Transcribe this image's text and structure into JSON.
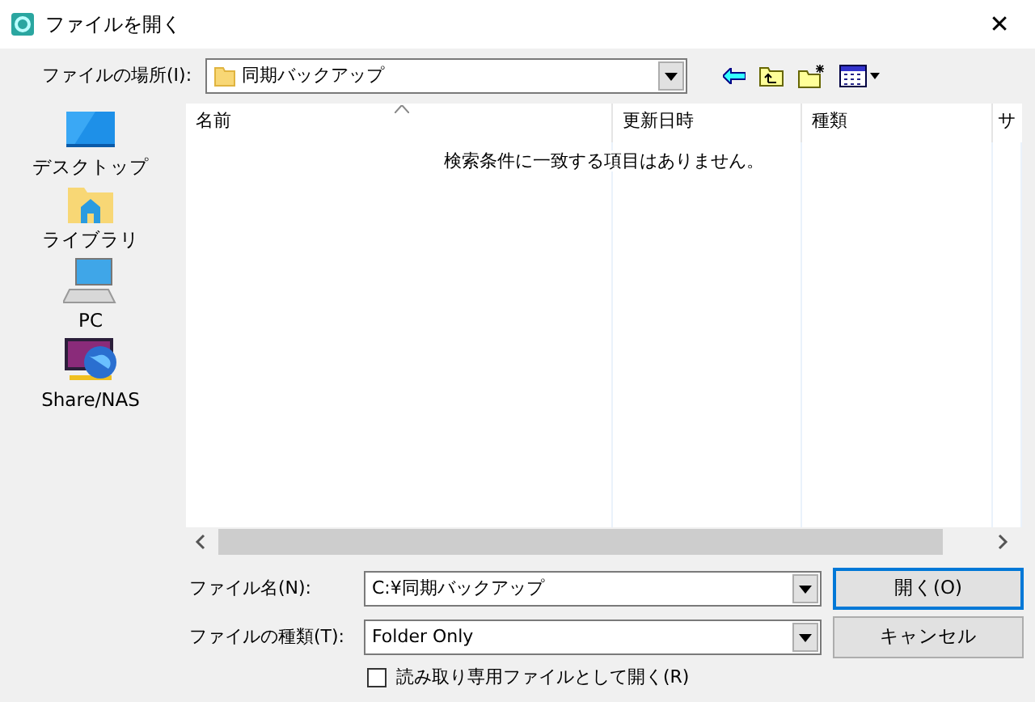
{
  "window": {
    "title": "ファイルを開く",
    "close": "✕"
  },
  "location": {
    "label": "ファイルの場所(I):",
    "value": "同期バックアップ"
  },
  "places": [
    {
      "label": "デスクトップ",
      "kind": "desktop"
    },
    {
      "label": "ライブラリ",
      "kind": "library"
    },
    {
      "label": "PC",
      "kind": "pc"
    },
    {
      "label": "Share/NAS",
      "kind": "nas"
    }
  ],
  "list": {
    "columns": [
      "名前",
      "更新日時",
      "種類",
      "サ"
    ],
    "empty_message": "検索条件に一致する項目はありません。"
  },
  "file_name": {
    "label": "ファイル名(N):",
    "value": "C:¥同期バックアップ"
  },
  "file_type": {
    "label": "ファイルの種類(T):",
    "value": "Folder Only"
  },
  "buttons": [
    "開く(O)",
    "キャンセル"
  ],
  "read_only": {
    "label": "読み取り専用ファイルとして開く(R)",
    "checked": false
  }
}
